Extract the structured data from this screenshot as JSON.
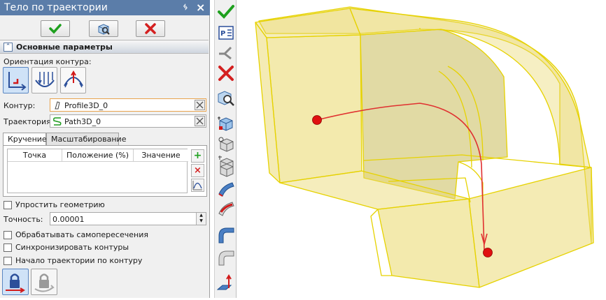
{
  "window": {
    "title": "Тело по траектории",
    "pin_icon": "pin-icon",
    "close_icon": "close-icon"
  },
  "top_buttons": {
    "ok_icon": "checkmark-icon",
    "preview_icon": "preview-icon",
    "cancel_icon": "cancel-x-icon"
  },
  "section": {
    "title": "Основные параметры",
    "collapse_glyph": "⌃"
  },
  "orientation": {
    "label": "Ориентация контура:",
    "options": [
      "orientation-fixed-icon",
      "orientation-parallel-icon",
      "orientation-normal-icon"
    ],
    "selected_index": 0
  },
  "contour": {
    "label": "Контур:",
    "value": "Profile3D_0"
  },
  "trajectory": {
    "label": "Траектория:",
    "value": "Path3D_0"
  },
  "tabs": [
    {
      "label": "Кручение",
      "active": true
    },
    {
      "label": "Масштабирование",
      "active": false
    }
  ],
  "twist_table": {
    "columns": [
      "Точка",
      "Положение (%)",
      "Значение"
    ],
    "rows": []
  },
  "table_buttons": {
    "add": "+",
    "remove": "×",
    "graph_icon": "curve-graph-icon"
  },
  "options": {
    "simplify": {
      "label": "Упростить геометрию",
      "checked": false
    },
    "accuracy_label": "Точность:",
    "accuracy_value": "0.00001",
    "self_intersections": {
      "label": "Обрабатывать самопересечения",
      "checked": false
    },
    "sync_contours": {
      "label": "Синхронизировать контуры",
      "checked": false
    },
    "start_by_contour": {
      "label": "Начало траектории по контуру",
      "checked": false
    }
  },
  "bottom_buttons": [
    "lock-arrow-icon",
    "lock-rotate-icon"
  ],
  "vertical_toolbar": [
    "checkmark-icon",
    "parameters-icon",
    "branch-icon",
    "cancel-x-icon",
    "zoom-preview-icon",
    "cube-point-icon",
    "cube-gear-icon",
    "cube-path-icon",
    "cube-hole-icon",
    "sweep-blue-icon",
    "sweep-red-icon",
    "bend-surface-icon",
    "pipe-icon",
    "normal-arrow-icon"
  ],
  "colors": {
    "title_bar": "#5b7da9",
    "accept": "#1ea01e",
    "cancel": "#d42020",
    "body_fill": "#e9d86a",
    "body_edge": "#e6d200",
    "path": "#e03030",
    "point": "#e01010"
  }
}
